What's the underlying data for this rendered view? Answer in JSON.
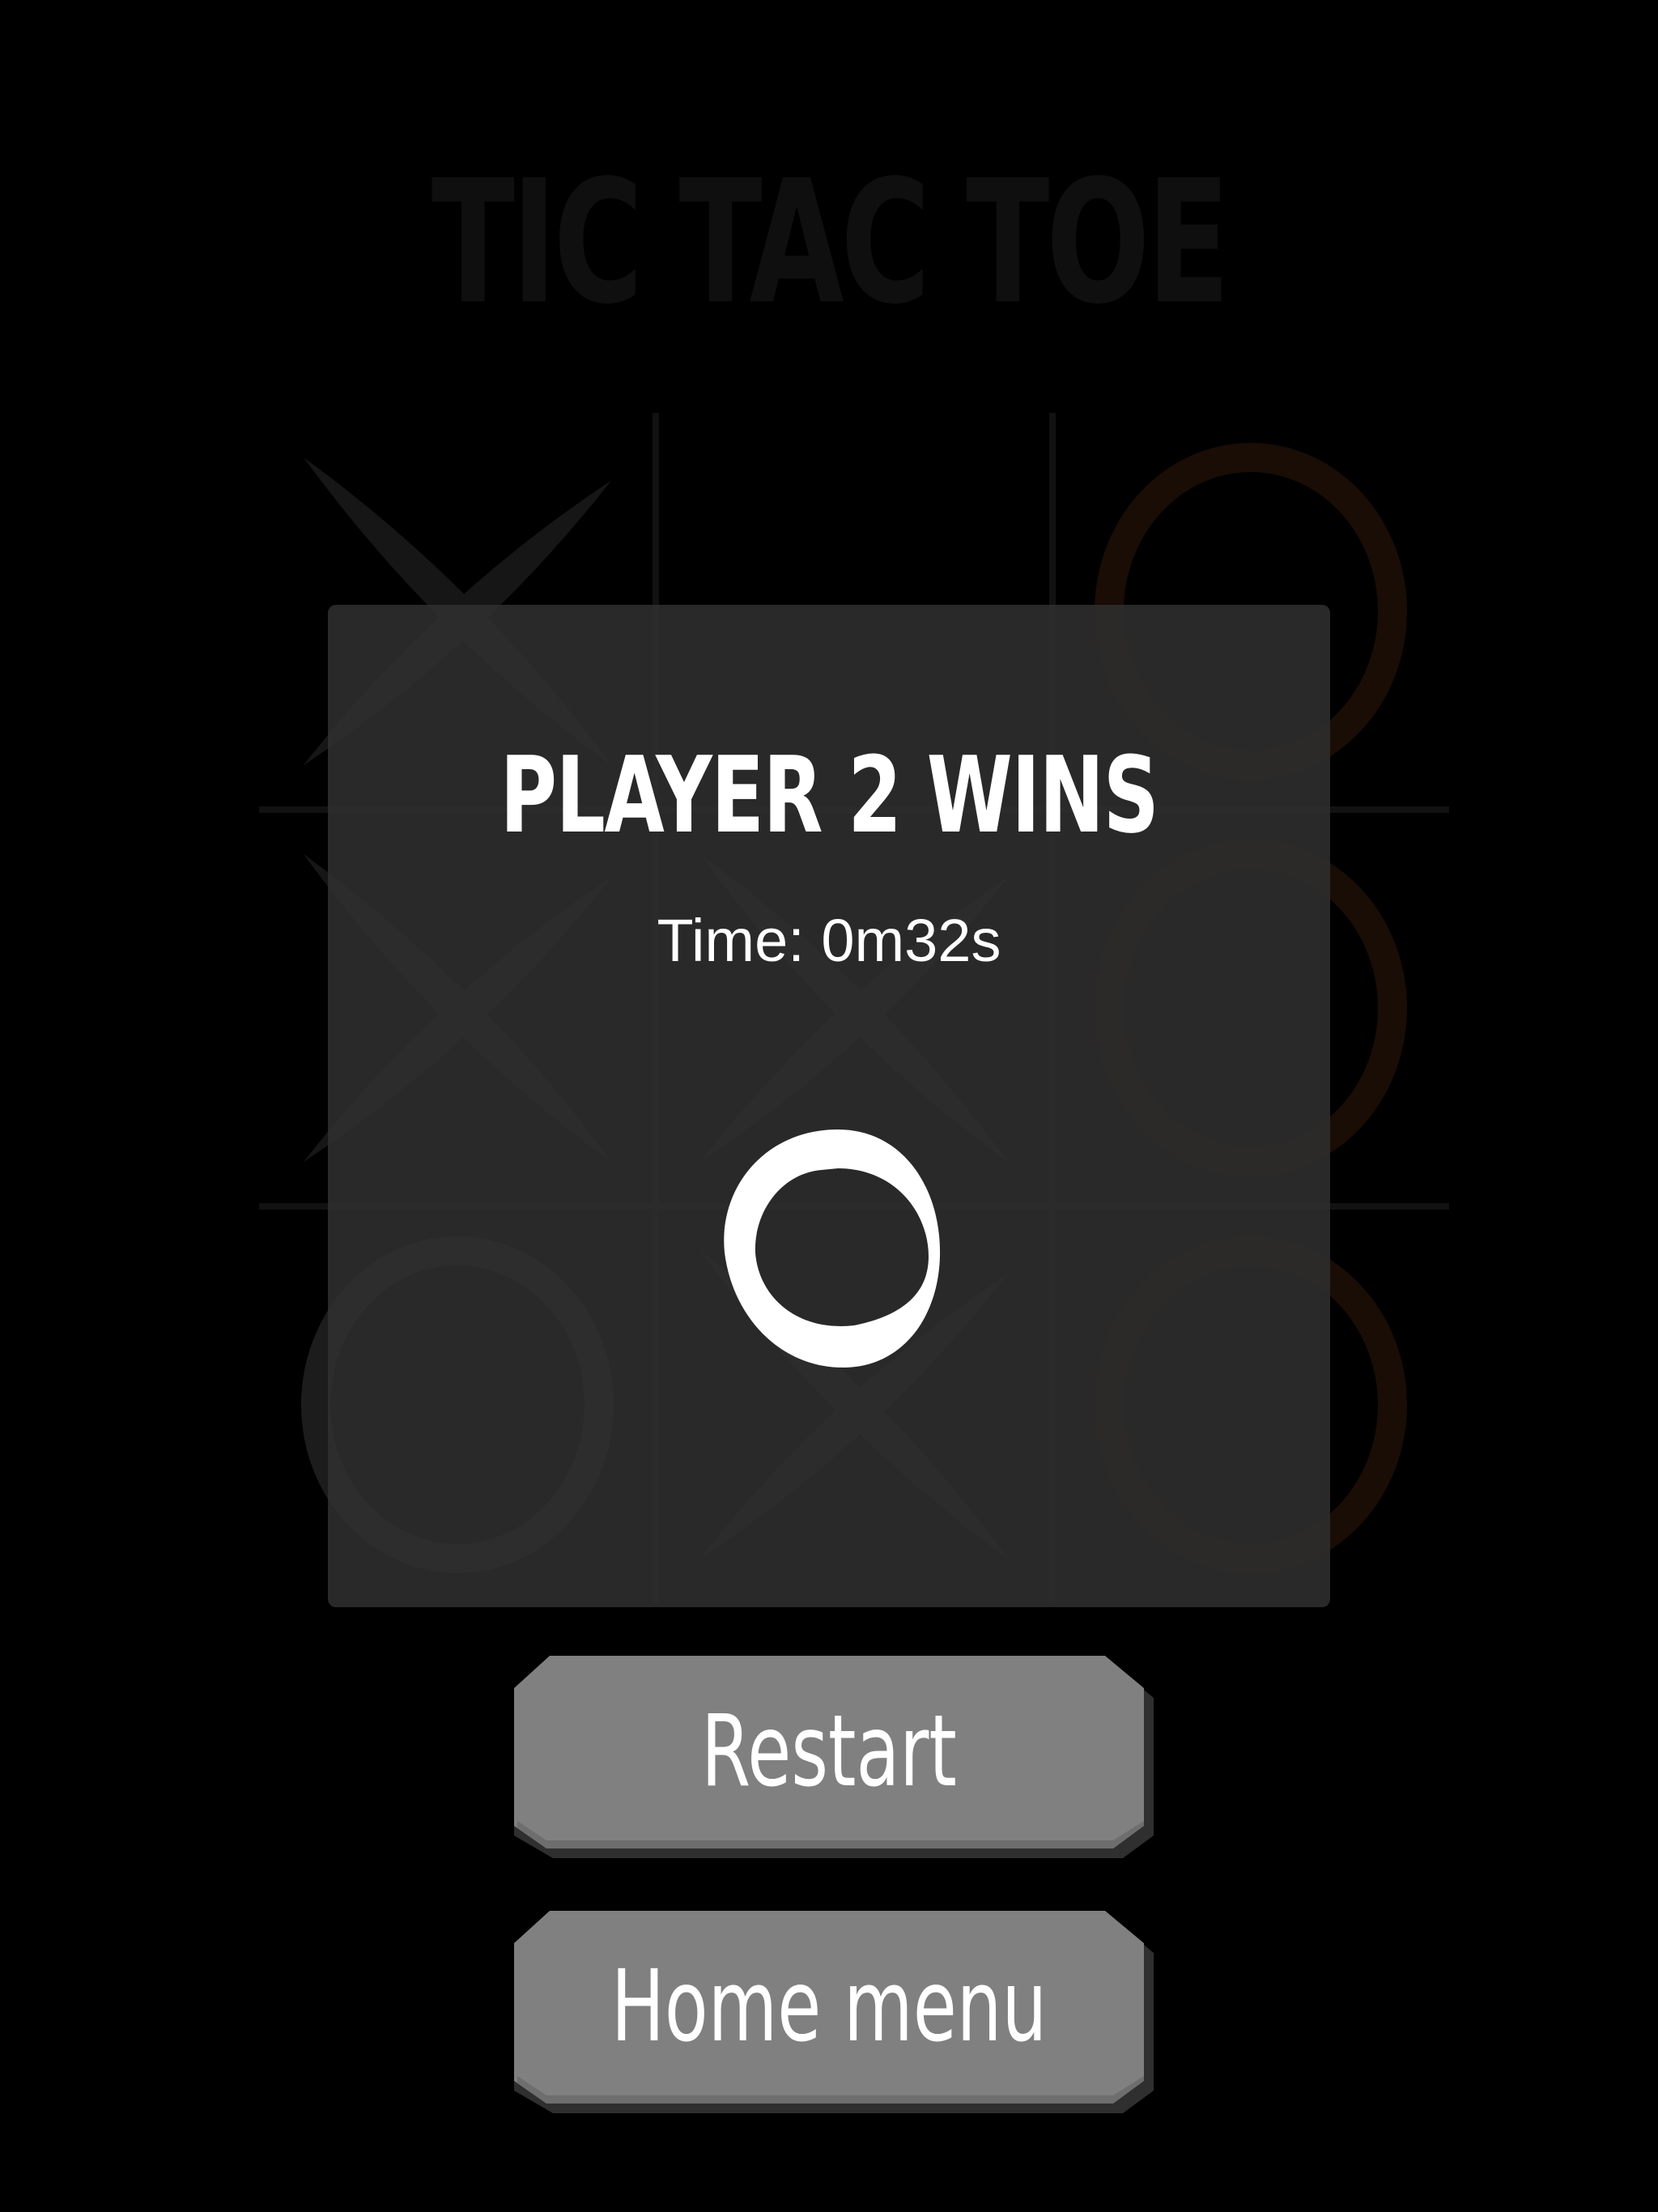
{
  "background": {
    "title": "TIC TAC TOE",
    "board": [
      [
        "X",
        "",
        "O"
      ],
      [
        "X",
        "X",
        "O"
      ],
      [
        "O",
        "X",
        "O"
      ]
    ],
    "colors": {
      "x_mark": "#161616",
      "o_mark_player1": "#1c1c1c",
      "o_mark_player2": "#190d06",
      "grid_line": "#121212",
      "title": "#0f0f0f"
    }
  },
  "modal": {
    "title": "PLAYER 2 WINS",
    "time": "Time: 0m32s",
    "winner_icon": "circle-o-icon"
  },
  "buttons": {
    "restart_label": "Restart",
    "home_label": "Home menu"
  },
  "colors": {
    "page_background": "#000000",
    "modal_background": "#2b2b2b",
    "button_face": "#808080",
    "button_shadow": "#3a3a3a",
    "text": "#ffffff"
  }
}
